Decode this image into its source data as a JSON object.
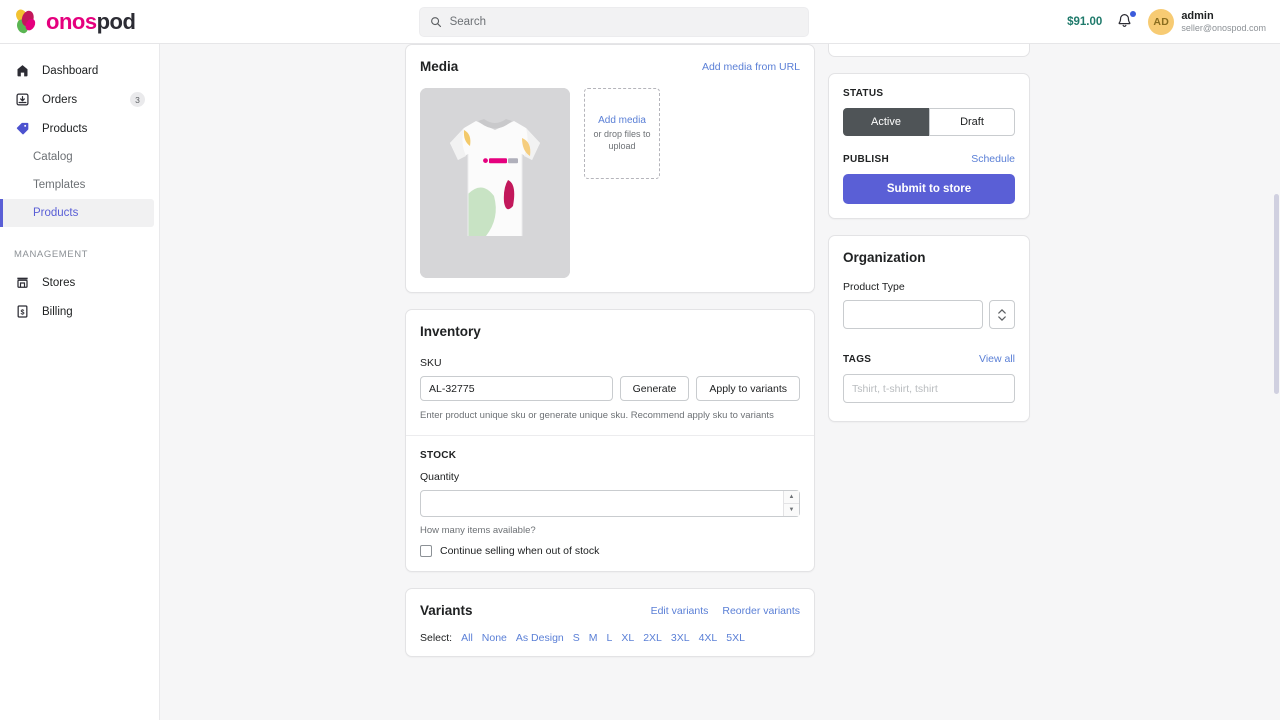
{
  "brand": {
    "part1": "onos",
    "part2": "pod"
  },
  "search": {
    "placeholder": "Search",
    "icon": "search-icon"
  },
  "topbar": {
    "balance": "$91.00",
    "bell_icon": "bell-icon",
    "avatar_initials": "AD",
    "user_name": "admin",
    "user_email": "seller@onospod.com"
  },
  "sidebar": {
    "items": [
      {
        "label": "Dashboard",
        "icon": "home-icon",
        "badge": ""
      },
      {
        "label": "Orders",
        "icon": "inbox-download-icon",
        "badge": "3"
      },
      {
        "label": "Products",
        "icon": "tag-icon",
        "badge": ""
      }
    ],
    "sub_items": [
      {
        "label": "Catalog",
        "active": false
      },
      {
        "label": "Templates",
        "active": false
      },
      {
        "label": "Products",
        "active": true
      }
    ],
    "section_label": "MANAGEMENT",
    "management_items": [
      {
        "label": "Stores",
        "icon": "store-icon"
      },
      {
        "label": "Billing",
        "icon": "billing-icon"
      }
    ]
  },
  "media": {
    "title": "Media",
    "add_from_url": "Add media from URL",
    "dropzone_main": "Add media",
    "dropzone_sub": "or drop files to upload",
    "thumbnail_alt": "tshirt-mockup"
  },
  "inventory": {
    "title": "Inventory",
    "sku_label": "SKU",
    "sku_value": "AL-32775",
    "generate_button": "Generate",
    "apply_button": "Apply to variants",
    "sku_help": "Enter product unique sku or generate unique sku. Recommend apply sku to variants",
    "stock_label": "STOCK",
    "quantity_label": "Quantity",
    "quantity_value": "",
    "quantity_help": "How many items available?",
    "continue_selling_label": "Continue selling when out of stock",
    "continue_selling_checked": false
  },
  "variants": {
    "title": "Variants",
    "edit_link": "Edit variants",
    "reorder_link": "Reorder variants",
    "select_label": "Select:",
    "options": [
      "All",
      "None",
      "As Design",
      "S",
      "M",
      "L",
      "XL",
      "2XL",
      "3XL",
      "4XL",
      "5XL"
    ]
  },
  "status": {
    "label": "STATUS",
    "active_label": "Active",
    "draft_label": "Draft",
    "selected": "Active"
  },
  "publish": {
    "label": "PUBLISH",
    "schedule_link": "Schedule",
    "submit_button": "Submit to store"
  },
  "organization": {
    "title": "Organization",
    "product_type_label": "Product Type",
    "product_type_value": "",
    "tags_label": "TAGS",
    "view_all_link": "View all",
    "tags_placeholder": "Tshirt, t-shirt, tshirt"
  },
  "colors": {
    "accent": "#5a5fd6",
    "link": "#5a7fd6",
    "brand_pink": "#e5007e",
    "balance_green": "#1f7a6b",
    "status_active_bg": "#4f5457"
  }
}
